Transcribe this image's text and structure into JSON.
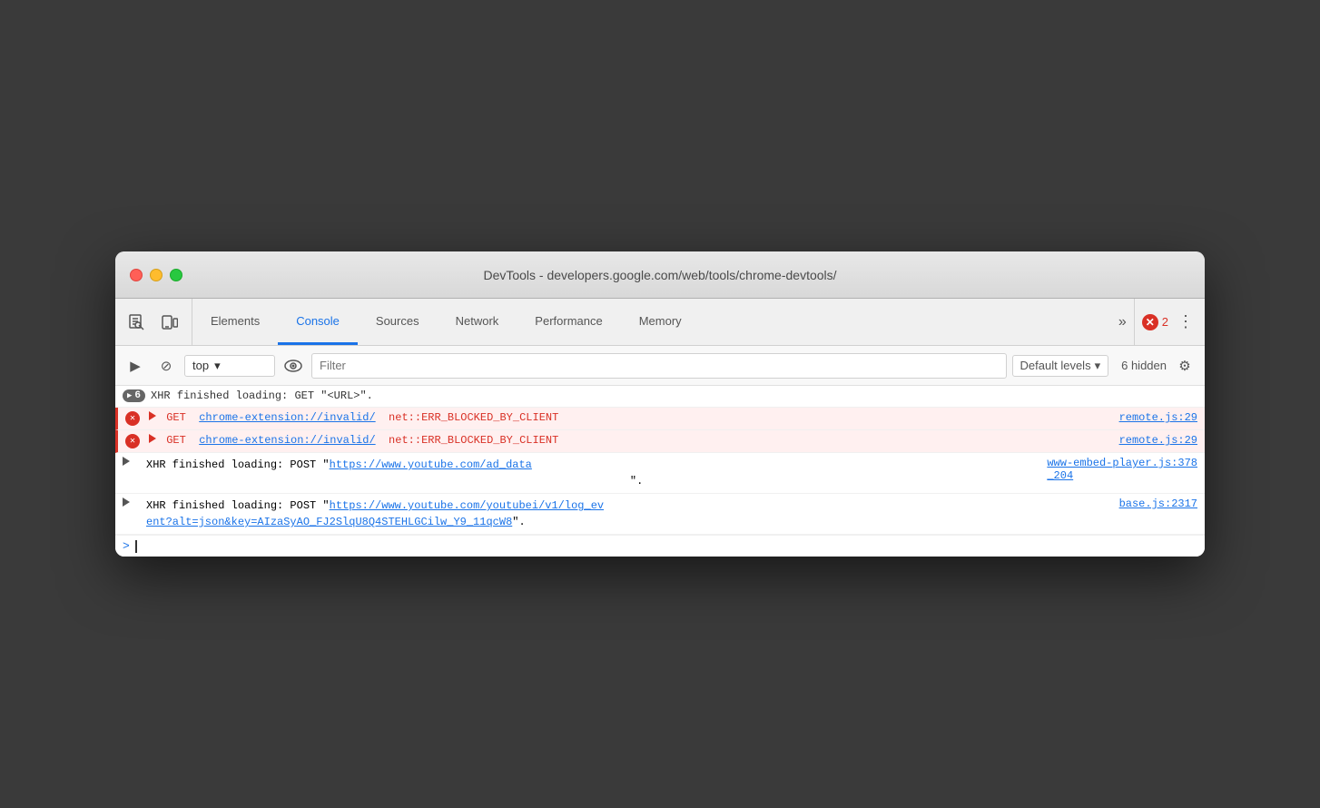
{
  "window": {
    "title": "DevTools - developers.google.com/web/tools/chrome-devtools/"
  },
  "traffic_lights": {
    "close_label": "close",
    "minimize_label": "minimize",
    "maximize_label": "maximize"
  },
  "toolbar": {
    "icons": [
      {
        "name": "inspect-icon",
        "symbol": "↖",
        "label": "Inspect"
      },
      {
        "name": "device-icon",
        "symbol": "⊡",
        "label": "Device"
      }
    ],
    "tabs": [
      {
        "id": "elements",
        "label": "Elements",
        "active": false
      },
      {
        "id": "console",
        "label": "Console",
        "active": true
      },
      {
        "id": "sources",
        "label": "Sources",
        "active": false
      },
      {
        "id": "network",
        "label": "Network",
        "active": false
      },
      {
        "id": "performance",
        "label": "Performance",
        "active": false
      },
      {
        "id": "memory",
        "label": "Memory",
        "active": false
      }
    ],
    "more_label": "»",
    "error_count": "2",
    "menu_symbol": "⋮"
  },
  "console_toolbar": {
    "run_btn": "▶",
    "block_btn": "⊘",
    "context_value": "top",
    "context_arrow": "▾",
    "filter_placeholder": "Filter",
    "levels_label": "Default levels",
    "levels_arrow": "▾",
    "hidden_label": "6 hidden",
    "settings_symbol": "⚙"
  },
  "console_entries": [
    {
      "type": "info",
      "badge": "6",
      "text": "XHR finished loading: GET \"<URL>\".",
      "source": null
    },
    {
      "type": "error",
      "method": "GET",
      "url": "chrome-extension://invalid/",
      "error": "net::ERR_BLOCKED_BY_CLIENT",
      "source": "remote.js:29"
    },
    {
      "type": "error",
      "method": "GET",
      "url": "chrome-extension://invalid/",
      "error": "net::ERR_BLOCKED_BY_CLIENT",
      "source": "remote.js:29"
    },
    {
      "type": "info",
      "text": "XHR finished loading: POST \"",
      "url": "https://www.youtube.com/ad_data",
      "text2": "",
      "source": "www-embed-player.js:378\n_204",
      "source_link": "www-embed-player.js:378",
      "full_text": "XHR finished loading: POST \"https://www.youtube.com/ad_data",
      "suffix": "\".",
      "source_label": "www-embed-player.js:378\n_204"
    },
    {
      "type": "info",
      "full_text": "XHR finished loading: POST \"https://www.youtube.com/youtubei/v1/log_ev\nent?alt=json&key=AIzaSyAO_FJ2SlqU8Q4STEHLGCilw_Y9_11qcW8\".",
      "source_label": "base.js:2317"
    }
  ],
  "input_row": {
    "prompt": ">"
  }
}
